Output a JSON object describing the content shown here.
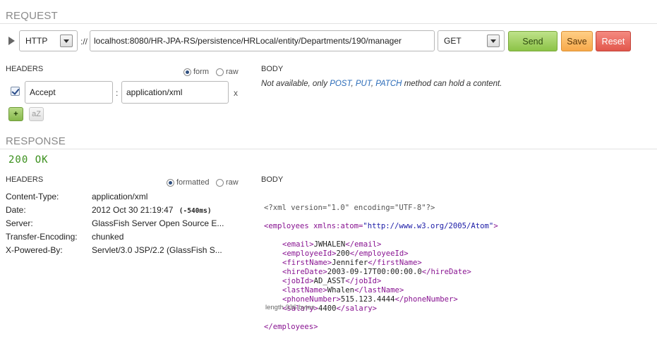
{
  "request": {
    "section_title": "REQUEST",
    "protocol": {
      "selected": "HTTP"
    },
    "url_separator": "://",
    "url_value": "localhost:8080/HR-JPA-RS/persistence/HRLocal/entity/Departments/190/manager",
    "method": {
      "selected": "GET"
    },
    "buttons": {
      "send": "Send",
      "save": "Save",
      "reset": "Reset"
    },
    "headers": {
      "title": "HEADERS",
      "mode_form": "form",
      "mode_raw": "raw",
      "mode_selected": "form",
      "rows": [
        {
          "checked": true,
          "name": "Accept",
          "separator": ":",
          "value": "application/xml",
          "remove": "x"
        }
      ],
      "add_label": "+",
      "sort_label": "aZ"
    },
    "body": {
      "title": "BODY",
      "note_prefix": "Not available, only",
      "note_methods": [
        "POST",
        "PUT",
        "PATCH"
      ],
      "note_sep1": ",",
      "note_sep2": ",",
      "note_suffix": "method can hold a content."
    }
  },
  "response": {
    "section_title": "RESPONSE",
    "status": "200 OK",
    "headers": {
      "title": "HEADERS",
      "mode_formatted": "formatted",
      "mode_raw": "raw",
      "mode_selected": "formatted",
      "rows": [
        {
          "key": "Content-Type:",
          "value": "application/xml",
          "extra": ""
        },
        {
          "key": "Date:",
          "value": "2012 Oct 30 21:19:47",
          "extra": "(-540ms)"
        },
        {
          "key": "Server:",
          "value": "GlassFish Server Open Source E...",
          "extra": ""
        },
        {
          "key": "Transfer-Encoding:",
          "value": "chunked",
          "extra": ""
        },
        {
          "key": "X-Powered-By:",
          "value": "Servlet/3.0 JSP/2.2 (GlassFish S...",
          "extra": ""
        }
      ]
    },
    "body": {
      "title": "BODY",
      "xml_declaration": "<?xml version=\"1.0\" encoding=\"UTF-8\"?>",
      "root_open_tag": "<employees",
      "root_attr_name": "xmlns:atom=",
      "root_attr_value": "\"http://www.w3.org/2005/Atom\"",
      "root_open_close": ">",
      "elements": [
        {
          "name": "email",
          "value": "JWHALEN"
        },
        {
          "name": "employeeId",
          "value": "200"
        },
        {
          "name": "firstName",
          "value": "Jennifer"
        },
        {
          "name": "hireDate",
          "value": "2003-09-17T00:00:00.0"
        },
        {
          "name": "jobId",
          "value": "AD_ASST"
        },
        {
          "name": "lastName",
          "value": "Whalen"
        },
        {
          "name": "phoneNumber",
          "value": "515.123.4444"
        },
        {
          "name": "salary",
          "value": "4400"
        }
      ],
      "root_close_tag": "</employees>",
      "length_note": "length 336 bytes"
    }
  },
  "icons": {
    "expand": "triangle-right-icon",
    "dropdown": "chevron-down-icon"
  },
  "colors": {
    "send": "#8cc347",
    "save": "#f7a94a",
    "reset": "#e2574c",
    "status_ok": "#3a8f1c",
    "link": "#2a6bb8",
    "xml_tag": "#881391",
    "xml_string": "#1a1aa6"
  }
}
